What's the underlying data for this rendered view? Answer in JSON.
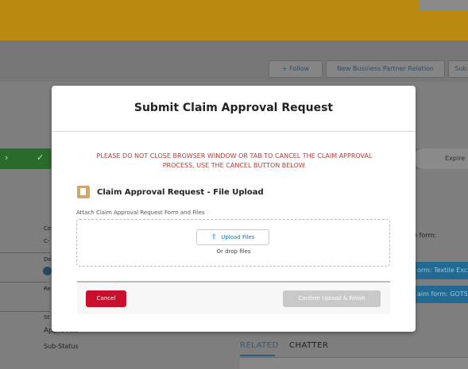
{
  "background": {
    "header_buttons": [
      {
        "icon": "plus-icon",
        "label": "+ Follow"
      },
      {
        "label": "New Business Partner Relation"
      },
      {
        "label": "Sub"
      }
    ],
    "path": {
      "check_glyph": "✓",
      "chevron_glyph": "›",
      "expire_label": "Expire"
    },
    "left_fields": {
      "f1": "Cer",
      "f2": "C-",
      "f3": "De",
      "f4": "Re",
      "f5": "St",
      "status_value": "Approved",
      "sub_status_label": "Sub-Status"
    },
    "right_fields": {
      "form_label": "n form:",
      "btn1": "orm: Textile Exch",
      "btn2": "aim form: GOTS"
    },
    "tabs": {
      "related": "RELATED",
      "chatter": "CHATTER"
    }
  },
  "modal": {
    "title": "Submit Claim Approval Request",
    "warning": "PLEASE DO NOT CLOSE BROWSER WINDOW OR TAB TO CANCEL THE CLAIM APPROVAL PROCESS, USE THE CANCEL BUTTON BELOW.",
    "upload_heading": "Claim Approval Request - File Upload",
    "attach_label": "Attach Claim Approval Request Form and Files",
    "upload_button": "Upload Files",
    "drop_text": "Or drop files",
    "cancel_button": "Cancel",
    "confirm_button": "Confirm Upload & Finish",
    "colors": {
      "warning": "#c23934",
      "cancel": "#c8102e",
      "accent": "#0b74c9"
    }
  }
}
